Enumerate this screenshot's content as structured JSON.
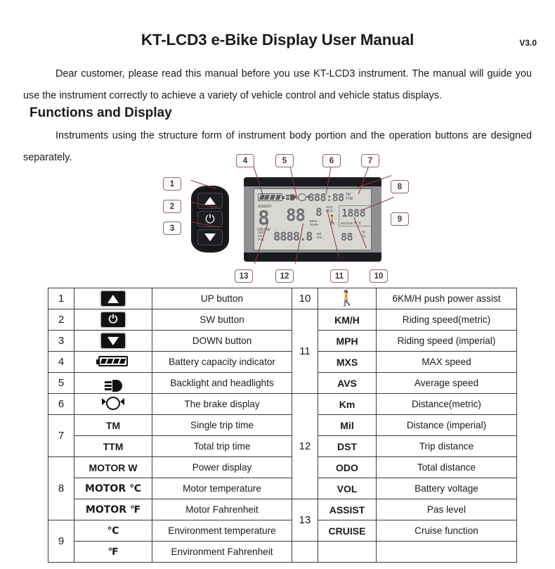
{
  "document": {
    "title": "KT-LCD3 e-Bike Display User Manual",
    "version": "V3.0",
    "intro_paragraph": "Dear customer, please read this manual before you use KT-LCD3 instrument. The manual will guide you use the instrument correctly to achieve a variety of vehicle control and vehicle status displays.",
    "section_title": "Functions and Display",
    "section_paragraph": "Instruments using the structure form of instrument body portion and the operation buttons are designed separately."
  },
  "diagram": {
    "callouts": [
      "1",
      "2",
      "3",
      "4",
      "5",
      "6",
      "7",
      "8",
      "9",
      "10",
      "11",
      "12",
      "13"
    ],
    "lcd_screen": {
      "time_value": "888:88",
      "time_labels": [
        "TM",
        "TTM"
      ],
      "assist_label": "ASSIST",
      "assist_value": "8",
      "cruise_label": "CRUISE",
      "speed_value": "88",
      "speed_decimal": "8",
      "speed_units": [
        "MPH",
        "Km/H"
      ],
      "avg_labels": [
        "AVG",
        "MXS"
      ],
      "motor_value": "1888",
      "motor_labels": "MOTOR  ℉ ℃",
      "odo_labels": [
        "ODO",
        "DST",
        "VOL"
      ],
      "distance_value": "8888.8",
      "distance_units": [
        "Mil",
        "Km"
      ],
      "temp_value": "88",
      "temp_units": [
        "℉",
        "℃"
      ]
    }
  },
  "table": {
    "left_rows": [
      {
        "num": "1",
        "rowspan": 1,
        "symbol_icon": "up-button-icon",
        "symbol_text": "",
        "desc": "UP button"
      },
      {
        "num": "2",
        "rowspan": 1,
        "symbol_icon": "power-button-icon",
        "symbol_text": "",
        "desc": "SW button"
      },
      {
        "num": "3",
        "rowspan": 1,
        "symbol_icon": "down-button-icon",
        "symbol_text": "",
        "desc": "DOWN button"
      },
      {
        "num": "4",
        "rowspan": 1,
        "symbol_icon": "battery-icon",
        "symbol_text": "",
        "desc": "Battery capacity indicator"
      },
      {
        "num": "5",
        "rowspan": 1,
        "symbol_icon": "headlight-icon",
        "symbol_text": "",
        "desc": "Backlight and headlights"
      },
      {
        "num": "6",
        "rowspan": 1,
        "symbol_icon": "brake-icon",
        "symbol_text": "",
        "desc": "The brake display"
      },
      {
        "num": "7",
        "rowspan": 2,
        "symbol_icon": "",
        "symbol_text": "TM",
        "desc": "Single trip time"
      },
      {
        "num": "",
        "rowspan": 0,
        "symbol_icon": "",
        "symbol_text": "TTM",
        "desc": "Total trip time"
      },
      {
        "num": "8",
        "rowspan": 3,
        "symbol_icon": "",
        "symbol_text": "MOTOR W",
        "desc": "Power display"
      },
      {
        "num": "",
        "rowspan": 0,
        "symbol_icon": "",
        "symbol_text": "MOTOR ℃",
        "desc": "Motor temperature"
      },
      {
        "num": "",
        "rowspan": 0,
        "symbol_icon": "",
        "symbol_text": "MOTOR ℉",
        "desc": "Motor Fahrenheit"
      },
      {
        "num": "9",
        "rowspan": 2,
        "symbol_icon": "",
        "symbol_text": "℃",
        "desc": "Environment temperature"
      },
      {
        "num": "",
        "rowspan": 0,
        "symbol_icon": "",
        "symbol_text": "℉",
        "desc": "Environment Fahrenheit"
      }
    ],
    "right_rows": [
      {
        "num": "10",
        "rowspan": 1,
        "symbol_icon": "walking-person-icon",
        "symbol_text": "",
        "desc": "6KM/H push power assist"
      },
      {
        "num": "11",
        "rowspan": 4,
        "symbol_icon": "",
        "symbol_text": "KM/H",
        "desc": "Riding speed(metric)"
      },
      {
        "num": "",
        "rowspan": 0,
        "symbol_icon": "",
        "symbol_text": "MPH",
        "desc": "Riding speed (imperial)"
      },
      {
        "num": "",
        "rowspan": 0,
        "symbol_icon": "",
        "symbol_text": "MXS",
        "desc": "MAX speed"
      },
      {
        "num": "",
        "rowspan": 0,
        "symbol_icon": "",
        "symbol_text": "AVS",
        "desc": "Average speed"
      },
      {
        "num": "12",
        "rowspan": 5,
        "symbol_icon": "",
        "symbol_text": "Km",
        "desc": "Distance(metric)"
      },
      {
        "num": "",
        "rowspan": 0,
        "symbol_icon": "",
        "symbol_text": "Mil",
        "desc": "Distance (imperial)"
      },
      {
        "num": "",
        "rowspan": 0,
        "symbol_icon": "",
        "symbol_text": "DST",
        "desc": "Trip distance"
      },
      {
        "num": "",
        "rowspan": 0,
        "symbol_icon": "",
        "symbol_text": "ODO",
        "desc": "Total distance"
      },
      {
        "num": "",
        "rowspan": 0,
        "symbol_icon": "",
        "symbol_text": "VOL",
        "desc": "Battery voltage"
      },
      {
        "num": "13",
        "rowspan": 2,
        "symbol_icon": "",
        "symbol_text": "ASSIST",
        "desc": "Pas level"
      },
      {
        "num": "",
        "rowspan": 0,
        "symbol_icon": "",
        "symbol_text": "CRUISE",
        "desc": "Cruise function"
      },
      {
        "num": "",
        "rowspan": 1,
        "symbol_icon": "",
        "symbol_text": "",
        "desc": ""
      }
    ]
  },
  "colors": {
    "callout_border": "#8a6a6a",
    "leader_line": "#8a3a35",
    "lcd_body": "#8f9094",
    "lcd_screen": "#d8d7d2",
    "table_border": "#3b3b3b"
  }
}
